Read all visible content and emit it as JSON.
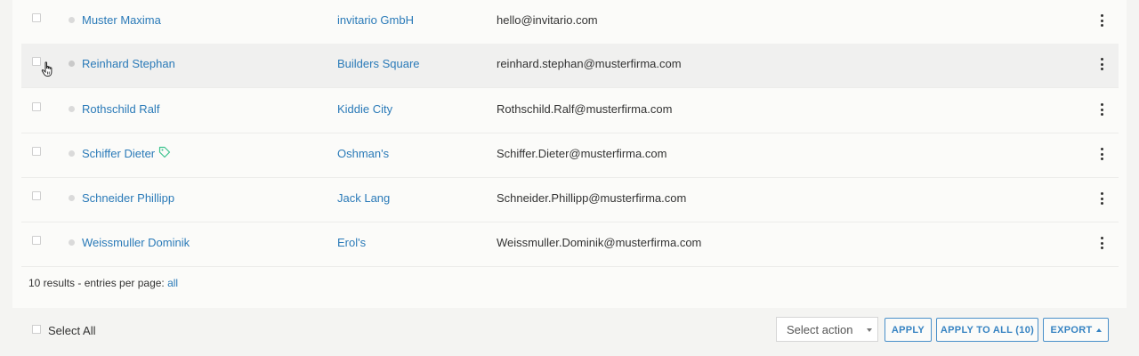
{
  "table": {
    "rows": [
      {
        "name": "Muster Maxima",
        "company": "invitario GmbH",
        "email": "hello@invitario.com",
        "tag": false
      },
      {
        "name": "Reinhard Stephan",
        "company": "Builders Square",
        "email": "reinhard.stephan@musterfirma.com",
        "tag": false
      },
      {
        "name": "Rothschild Ralf",
        "company": "Kiddie City",
        "email": "Rothschild.Ralf@musterfirma.com",
        "tag": false
      },
      {
        "name": "Schiffer Dieter",
        "company": "Oshman's",
        "email": "Schiffer.Dieter@musterfirma.com",
        "tag": true
      },
      {
        "name": "Schneider Phillipp",
        "company": "Jack Lang",
        "email": "Schneider.Phillipp@musterfirma.com",
        "tag": false
      },
      {
        "name": "Weissmuller Dominik",
        "company": "Erol's",
        "email": "Weissmuller.Dominik@musterfirma.com",
        "tag": false
      }
    ]
  },
  "footer": {
    "results_count": "10 results",
    "per_page_text": " - entries per page: ",
    "per_page_value": "all"
  },
  "bulk": {
    "select_all_label": "Select All",
    "select_action_value": "Select action",
    "apply_label": "APPLY",
    "apply_all_label": "APPLY TO ALL (10)",
    "export_label": "EXPORT"
  },
  "colors": {
    "link": "#2a7ab8",
    "tag_icon": "#3cc38e",
    "button_border": "#4a90c9"
  },
  "icons": {
    "row_menu": "vertical-ellipsis-icon",
    "tag": "tag-icon",
    "cursor": "hand-pointer-icon"
  }
}
